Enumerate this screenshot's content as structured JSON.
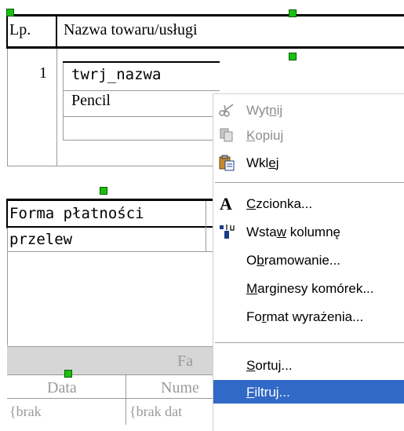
{
  "table1": {
    "col_lp": "Lp.",
    "col_name": "Nazwa towaru/usługi",
    "row_num": "1",
    "row_value1": "twrj_nazwa",
    "row_value2": "Pencil"
  },
  "table2": {
    "header": "Forma płatności",
    "value": "przelew"
  },
  "table3": {
    "title_partial": "Fa",
    "col_data": "Data",
    "col_numer_partial": "Nume",
    "cell1": "{brak",
    "cell2": "{brak dat"
  },
  "context_menu": {
    "items": [
      {
        "pre": "Wyt",
        "u": "n",
        "post": "ij",
        "enabled": false,
        "icon": "scissors-icon"
      },
      {
        "pre": "",
        "u": "K",
        "post": "opiuj",
        "enabled": false,
        "icon": "copy-icon"
      },
      {
        "pre": "Wkl",
        "u": "e",
        "post": "j",
        "enabled": true,
        "icon": "paste-icon"
      },
      {
        "pre": "",
        "u": "C",
        "post": "zcionka...",
        "enabled": true,
        "icon": "font-icon"
      },
      {
        "pre": "Wsta",
        "u": "w",
        "post": " kolumnę",
        "enabled": true,
        "icon": "insert-column-icon"
      },
      {
        "pre": "O",
        "u": "b",
        "post": "ramowanie...",
        "enabled": true
      },
      {
        "pre": "",
        "u": "M",
        "post": "arginesy komórek...",
        "enabled": true
      },
      {
        "pre": "Fo",
        "u": "r",
        "post": "mat wyrażenia...",
        "enabled": true
      },
      {
        "pre": "",
        "u": "S",
        "post": "ortuj...",
        "enabled": true
      },
      {
        "pre": "",
        "u": "F",
        "post": "iltruj...",
        "enabled": true,
        "highlighted": true
      }
    ]
  },
  "colors": {
    "handle": "#16c20e",
    "menu_highlight": "#3169c6",
    "disabled_text": "#8d8d8d"
  }
}
